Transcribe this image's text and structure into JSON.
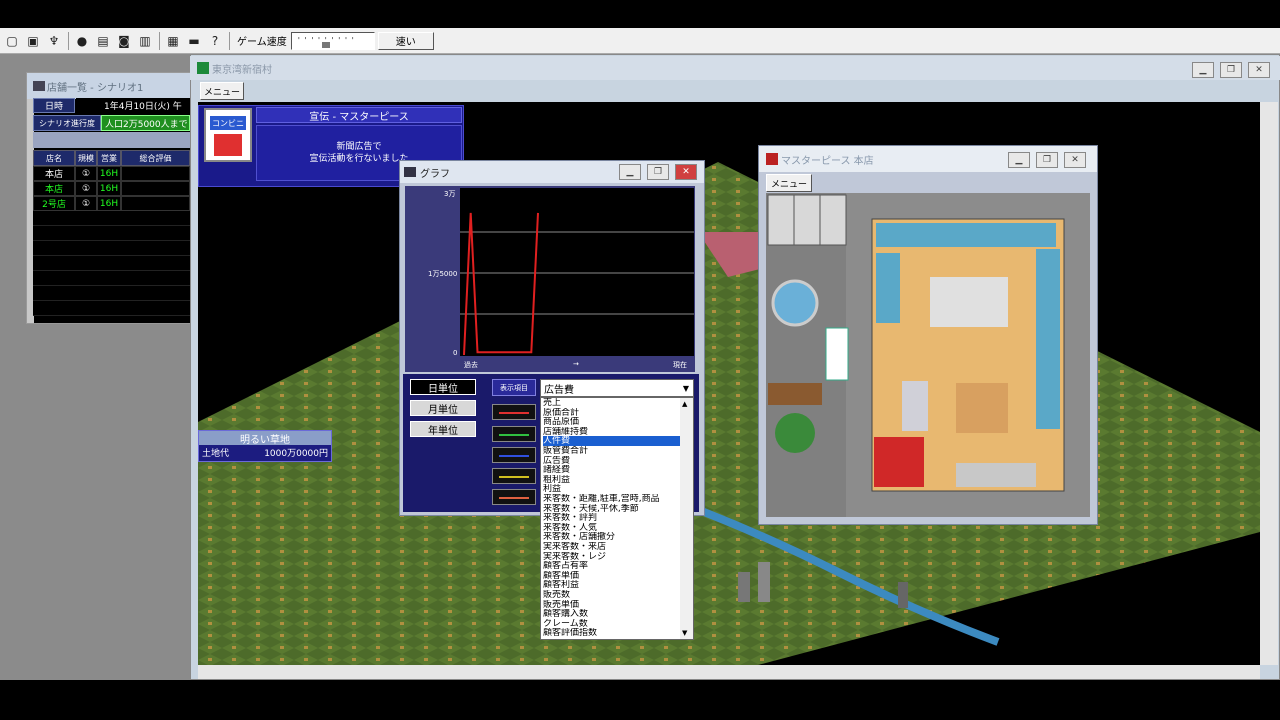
{
  "toolbar": {
    "icons": [
      "new-file-icon",
      "save-icon",
      "tool-icon",
      "search-icon",
      "calculator-icon",
      "camera-icon",
      "book-icon",
      "map-icon",
      "monitor-icon",
      "help-icon"
    ],
    "speed_label": "ゲーム速度",
    "fast_label": "速い"
  },
  "store_list": {
    "title": "店舗一覧 - シナリオ1",
    "date_label": "日時",
    "date_value": "1年4月10日(火) 午",
    "progress_label": "シナリオ進行度",
    "progress_value": "人口2万5000人まで",
    "headers": [
      "店名",
      "規模",
      "営業",
      "総合評価"
    ],
    "rows": [
      {
        "name": "本店",
        "size": "①",
        "hours": "16H",
        "rating": ""
      },
      {
        "name": "本店",
        "size": "①",
        "hours": "16H",
        "rating": ""
      },
      {
        "name": "2号店",
        "size": "①",
        "hours": "16H",
        "rating": ""
      }
    ]
  },
  "city": {
    "title": "東京湾新宿村",
    "menu_label": "メニュー"
  },
  "ad": {
    "logo_text": "コンビニ",
    "header": "宣伝 - マスターピース",
    "line1": "新聞広告で",
    "line2": "宣伝活動を行ないました"
  },
  "land": {
    "title": "明るい草地",
    "label": "土地代",
    "price": "1000万0000円"
  },
  "graph": {
    "title": "グラフ",
    "y_top": "3万",
    "y_mid": "1万5000",
    "y_bottom": "0",
    "x_left": "過去",
    "x_mid": "→",
    "x_right": "現在",
    "unit_day": "日単位",
    "unit_month": "月単位",
    "unit_year": "年単位",
    "display_label": "表示項目",
    "swatch_colors": [
      "#e03030",
      "#30c040",
      "#3050e0",
      "#d0c020",
      "#e06040"
    ],
    "dropdown_value": "広告費",
    "dropdown_items": [
      "売上",
      "原価合計",
      "商品原価",
      "店舗維持費",
      "人件費",
      "販管費合計",
      "広告費",
      "諸経費",
      "粗利益",
      "利益",
      "来客数・距離,駐車,営時,商品",
      "来客数・天候,平休,季節",
      "来客数・評判",
      "来客数・人気",
      "来客数・店舗撤分",
      "実来客数・来店",
      "実来客数・レジ",
      "顧客占有率",
      "顧客単価",
      "顧客利益",
      "販売数",
      "販売単価",
      "顧客購入数",
      "クレーム数",
      "顧客評価指数"
    ],
    "selected_index": 4
  },
  "chart_data": {
    "type": "line",
    "title": "",
    "ylabel": "",
    "xlabel": "",
    "ylim": [
      0,
      30000
    ],
    "yticks": [
      "0",
      "1万5000",
      "3万"
    ],
    "x": [
      "過去",
      "→",
      "現在"
    ],
    "series": [
      {
        "values": [
          0,
          26000,
          500,
          500,
          500,
          500,
          500,
          500,
          500,
          500,
          500,
          26000
        ]
      }
    ],
    "color": "#e02020"
  },
  "shop": {
    "title": "マスターピース 本店",
    "menu_label": "メニュー"
  }
}
